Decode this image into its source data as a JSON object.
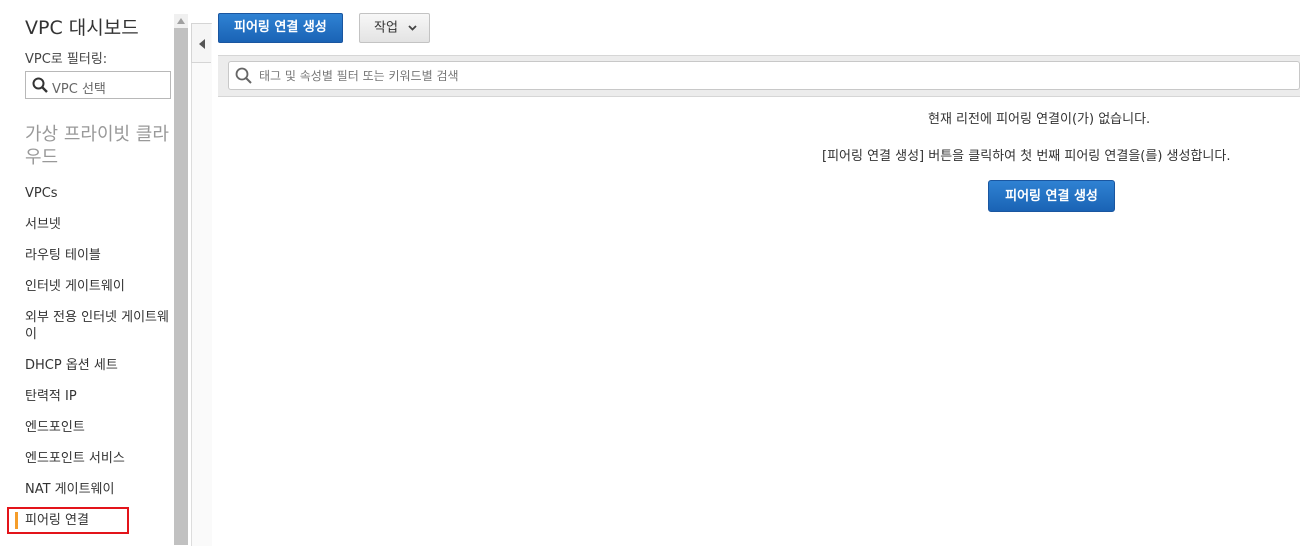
{
  "sidebar": {
    "title": "VPC 대시보드",
    "filter_label": "VPC로 필터링:",
    "vpc_select_placeholder": "VPC 선택",
    "section_title": "가상 프라이빗 클라우드",
    "items": [
      {
        "label": "VPCs"
      },
      {
        "label": "서브넷"
      },
      {
        "label": "라우팅 테이블"
      },
      {
        "label": "인터넷 게이트웨이"
      },
      {
        "label": "외부 전용 인터넷 게이트웨이"
      },
      {
        "label": "DHCP 옵션 세트"
      },
      {
        "label": "탄력적 IP"
      },
      {
        "label": "엔드포인트"
      },
      {
        "label": "엔드포인트 서비스"
      },
      {
        "label": "NAT 게이트웨이"
      },
      {
        "label": "피어링 연결",
        "active": true
      }
    ]
  },
  "toolbar": {
    "create_label": "피어링 연결 생성",
    "actions_label": "작업"
  },
  "search": {
    "placeholder": "태그 및 속성별 필터 또는 키워드별 검색"
  },
  "empty_state": {
    "line1": "현재 리전에 피어링 연결이(가) 없습니다.",
    "line2": "[피어링 연결 생성] 버튼을 클릭하여 첫 번째 피어링 연결을(를) 생성합니다.",
    "button_label": "피어링 연결 생성"
  },
  "colors": {
    "primary": "#1f6fc5",
    "active_indicator": "#f59d2a",
    "highlight_border": "#e3141a"
  }
}
